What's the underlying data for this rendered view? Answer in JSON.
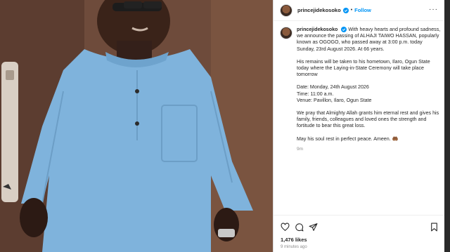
{
  "header": {
    "username": "princejidekosoko",
    "separator": "•",
    "follow_label": "Follow",
    "more_label": "···"
  },
  "caption": {
    "username": "princejidekosoko",
    "paragraphs": [
      "With heavy hearts and profound sadness, we announce the passing of ALHAJI TAIWO HASSAN, popularly known as OGOGO, who passed away at 3:00 p.m. today Sunday, 23rd August 2026. At 66 years.",
      "His remains will be taken to his hometown, Ilaro, Ogun State today where the Laying-in-State Ceremony will take place tomorrow",
      "Date: Monday, 24th August 2026\nTime: 11:00 a.m.\nVenue: Pavillon, Ilaro, Ogun State",
      "We pray that Almighty Allah grants him eternal rest and gives his family, friends, colleagues and loved ones the strength and fortitude to bear this great loss.",
      "May his soul rest in perfect peace. Ameen. 🤲🏾"
    ],
    "age": "9m"
  },
  "footer": {
    "likes": "1,476 likes",
    "time_ago": "9 minutes ago"
  },
  "icons": [
    "heart-icon",
    "comment-icon",
    "share-icon",
    "bookmark-icon",
    "verified-icon"
  ],
  "colors": {
    "accent": "#0095f6",
    "text": "#262626",
    "muted": "#8e8e8e",
    "agbada": "#7fb3dc"
  }
}
